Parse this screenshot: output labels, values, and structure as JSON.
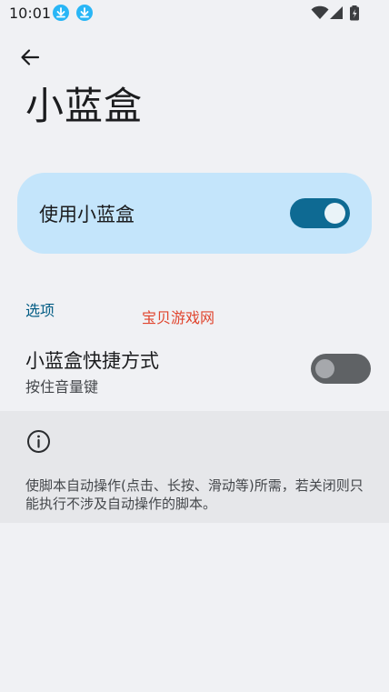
{
  "status_bar": {
    "time": "10:01",
    "icons": [
      "download-icon",
      "download-icon",
      "wifi-icon",
      "signal-icon",
      "battery-charging-icon"
    ]
  },
  "header": {
    "back_icon": "arrow-left-icon",
    "title": "小蓝盒"
  },
  "main_toggle": {
    "label": "使用小蓝盒",
    "checked": true
  },
  "options": {
    "section_title": "选项",
    "shortcut": {
      "title": "小蓝盒快捷方式",
      "subtitle": "按住音量键",
      "checked": false
    }
  },
  "watermark": "宝贝游戏网",
  "info": {
    "icon": "info-icon",
    "text": "使脚本自动操作(点击、长按、滑动等)所需，若关闭则只能执行不涉及自动操作的脚本。"
  },
  "colors": {
    "background": "#f0f1f4",
    "card": "#c4e5fb",
    "accent": "#0e6a93",
    "section_header": "#005b83",
    "watermark": "#e0452e"
  }
}
